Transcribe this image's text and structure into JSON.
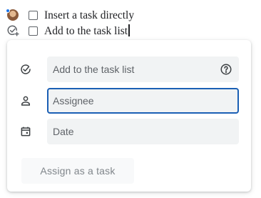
{
  "doc": {
    "line1_text": "Insert a task directly",
    "line2_text": "Add to the task list"
  },
  "task_card": {
    "title_value": "Add to the task list",
    "assignee_placeholder": "Assignee",
    "date_placeholder": "Date",
    "assign_button_label": "Assign as a task"
  },
  "icons": {
    "avatar": "user-avatar-icon",
    "add_task": "add-task-icon",
    "task_check": "check-circle-icon",
    "help": "help-icon",
    "person": "person-icon",
    "calendar": "calendar-icon"
  },
  "colors": {
    "accent": "#1a5fb4",
    "presence_dot": "#1a73e8",
    "field_bg": "#f1f3f4",
    "muted_text": "#5f6368"
  }
}
